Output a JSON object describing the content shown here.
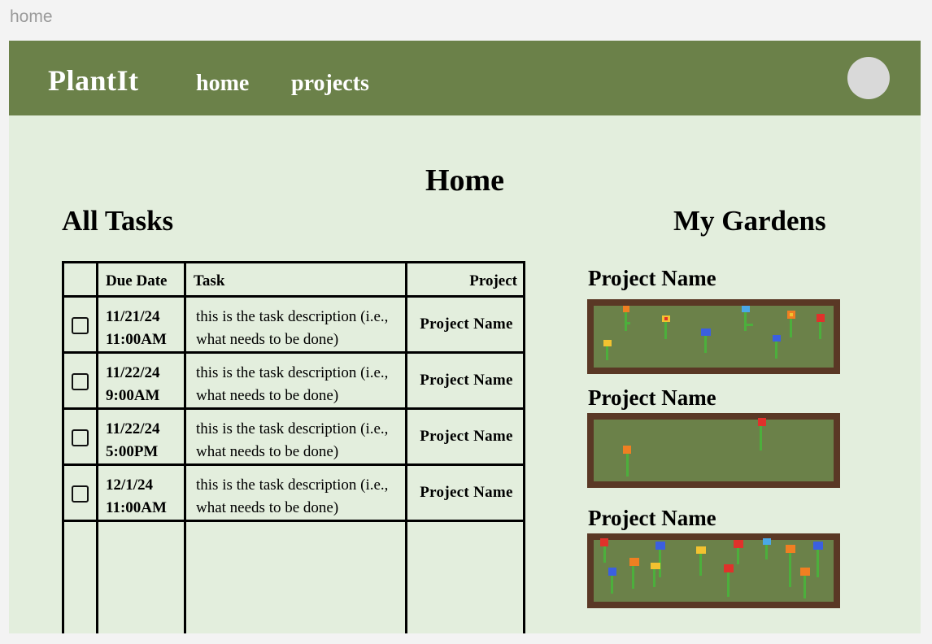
{
  "frame": {
    "label": "home"
  },
  "nav": {
    "brand": "PlantIt",
    "links": [
      {
        "label": "home"
      },
      {
        "label": "projects"
      }
    ]
  },
  "page": {
    "title": "Home"
  },
  "tasks": {
    "title": "All Tasks",
    "headers": {
      "due": "Due Date",
      "task": "Task",
      "project": "Project"
    },
    "rows": [
      {
        "date": "11/21/24",
        "time": "11:00AM",
        "desc1": "this is the task description (i.e.,",
        "desc2": "what needs to be done)",
        "project": "Project Name",
        "checked": false
      },
      {
        "date": "11/22/24",
        "time": "9:00AM",
        "desc1": "this is the task description (i.e.,",
        "desc2": "what needs to be done)",
        "project": "Project Name",
        "checked": false
      },
      {
        "date": "11/22/24",
        "time": "5:00PM",
        "desc1": "this is the task description (i.e.,",
        "desc2": "what needs to be done)",
        "project": "Project Name",
        "checked": false
      },
      {
        "date": "12/1/24",
        "time": "11:00AM",
        "desc1": "this is the task description (i.e.,",
        "desc2": "what needs to be done)",
        "project": "Project Name",
        "checked": false
      }
    ]
  },
  "gardens": {
    "title": "My Gardens",
    "items": [
      {
        "name": "Project Name"
      },
      {
        "name": "Project Name"
      },
      {
        "name": "Project Name"
      }
    ]
  },
  "colors": {
    "navbar": "#6b8149",
    "page_bg": "#e3eedd",
    "bed_frame": "#5a3825",
    "bed_soil": "#6b8149",
    "stem": "#4caf3c",
    "flower_red": "#e0312b",
    "flower_orange": "#ef7f22",
    "flower_yellow": "#f2c230",
    "flower_blue": "#3b5fe0",
    "flower_sky": "#4aa8e8"
  }
}
